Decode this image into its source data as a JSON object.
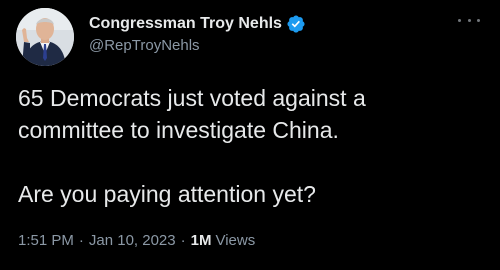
{
  "author": {
    "display_name": "Congressman Troy Nehls",
    "handle": "@RepTroyNehls",
    "avatar_icon": "profile-photo",
    "verified_icon": "verified-badge-icon",
    "verified_color": "#1d9bf0"
  },
  "menu": {
    "more_icon": "more-options-icon"
  },
  "tweet": {
    "text": "65 Democrats just voted against a\ncommittee to investigate China.\n\nAre you paying attention yet?"
  },
  "meta": {
    "time": "1:51 PM",
    "separator_1": "·",
    "date": "Jan 10, 2023",
    "separator_2": "·",
    "views_count": "1M",
    "views_label": "Views"
  },
  "colors": {
    "background": "#000000",
    "primary_text": "#e7e9ea",
    "secondary_text": "#8b98a5",
    "accent": "#1d9bf0"
  }
}
